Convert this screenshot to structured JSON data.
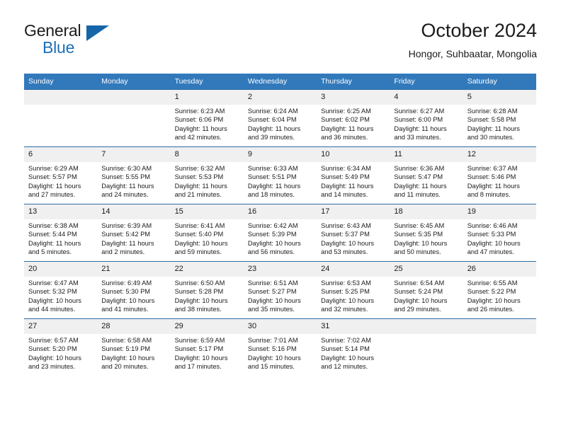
{
  "brand": {
    "line1": "General",
    "line2": "Blue",
    "flag_icon": "blue-flag-triangle-icon",
    "accent_color": "#1d6fb8"
  },
  "header": {
    "title": "October 2024",
    "location": "Hongor, Suhbaatar, Mongolia"
  },
  "theme": {
    "header_row_bg": "#3279bb",
    "daynum_bg": "#f0f0f0",
    "row_rule": "#2e6da4",
    "text": "#1b1b1b"
  },
  "weekdays": [
    "Sunday",
    "Monday",
    "Tuesday",
    "Wednesday",
    "Thursday",
    "Friday",
    "Saturday"
  ],
  "weeks": [
    [
      {
        "day": "",
        "sunrise": "",
        "sunset": "",
        "daylight1": "",
        "daylight2": "",
        "empty": true
      },
      {
        "day": "",
        "sunrise": "",
        "sunset": "",
        "daylight1": "",
        "daylight2": "",
        "empty": true
      },
      {
        "day": "1",
        "sunrise": "Sunrise: 6:23 AM",
        "sunset": "Sunset: 6:06 PM",
        "daylight1": "Daylight: 11 hours",
        "daylight2": "and 42 minutes."
      },
      {
        "day": "2",
        "sunrise": "Sunrise: 6:24 AM",
        "sunset": "Sunset: 6:04 PM",
        "daylight1": "Daylight: 11 hours",
        "daylight2": "and 39 minutes."
      },
      {
        "day": "3",
        "sunrise": "Sunrise: 6:25 AM",
        "sunset": "Sunset: 6:02 PM",
        "daylight1": "Daylight: 11 hours",
        "daylight2": "and 36 minutes."
      },
      {
        "day": "4",
        "sunrise": "Sunrise: 6:27 AM",
        "sunset": "Sunset: 6:00 PM",
        "daylight1": "Daylight: 11 hours",
        "daylight2": "and 33 minutes."
      },
      {
        "day": "5",
        "sunrise": "Sunrise: 6:28 AM",
        "sunset": "Sunset: 5:58 PM",
        "daylight1": "Daylight: 11 hours",
        "daylight2": "and 30 minutes."
      }
    ],
    [
      {
        "day": "6",
        "sunrise": "Sunrise: 6:29 AM",
        "sunset": "Sunset: 5:57 PM",
        "daylight1": "Daylight: 11 hours",
        "daylight2": "and 27 minutes."
      },
      {
        "day": "7",
        "sunrise": "Sunrise: 6:30 AM",
        "sunset": "Sunset: 5:55 PM",
        "daylight1": "Daylight: 11 hours",
        "daylight2": "and 24 minutes."
      },
      {
        "day": "8",
        "sunrise": "Sunrise: 6:32 AM",
        "sunset": "Sunset: 5:53 PM",
        "daylight1": "Daylight: 11 hours",
        "daylight2": "and 21 minutes."
      },
      {
        "day": "9",
        "sunrise": "Sunrise: 6:33 AM",
        "sunset": "Sunset: 5:51 PM",
        "daylight1": "Daylight: 11 hours",
        "daylight2": "and 18 minutes."
      },
      {
        "day": "10",
        "sunrise": "Sunrise: 6:34 AM",
        "sunset": "Sunset: 5:49 PM",
        "daylight1": "Daylight: 11 hours",
        "daylight2": "and 14 minutes."
      },
      {
        "day": "11",
        "sunrise": "Sunrise: 6:36 AM",
        "sunset": "Sunset: 5:47 PM",
        "daylight1": "Daylight: 11 hours",
        "daylight2": "and 11 minutes."
      },
      {
        "day": "12",
        "sunrise": "Sunrise: 6:37 AM",
        "sunset": "Sunset: 5:46 PM",
        "daylight1": "Daylight: 11 hours",
        "daylight2": "and 8 minutes."
      }
    ],
    [
      {
        "day": "13",
        "sunrise": "Sunrise: 6:38 AM",
        "sunset": "Sunset: 5:44 PM",
        "daylight1": "Daylight: 11 hours",
        "daylight2": "and 5 minutes."
      },
      {
        "day": "14",
        "sunrise": "Sunrise: 6:39 AM",
        "sunset": "Sunset: 5:42 PM",
        "daylight1": "Daylight: 11 hours",
        "daylight2": "and 2 minutes."
      },
      {
        "day": "15",
        "sunrise": "Sunrise: 6:41 AM",
        "sunset": "Sunset: 5:40 PM",
        "daylight1": "Daylight: 10 hours",
        "daylight2": "and 59 minutes."
      },
      {
        "day": "16",
        "sunrise": "Sunrise: 6:42 AM",
        "sunset": "Sunset: 5:39 PM",
        "daylight1": "Daylight: 10 hours",
        "daylight2": "and 56 minutes."
      },
      {
        "day": "17",
        "sunrise": "Sunrise: 6:43 AM",
        "sunset": "Sunset: 5:37 PM",
        "daylight1": "Daylight: 10 hours",
        "daylight2": "and 53 minutes."
      },
      {
        "day": "18",
        "sunrise": "Sunrise: 6:45 AM",
        "sunset": "Sunset: 5:35 PM",
        "daylight1": "Daylight: 10 hours",
        "daylight2": "and 50 minutes."
      },
      {
        "day": "19",
        "sunrise": "Sunrise: 6:46 AM",
        "sunset": "Sunset: 5:33 PM",
        "daylight1": "Daylight: 10 hours",
        "daylight2": "and 47 minutes."
      }
    ],
    [
      {
        "day": "20",
        "sunrise": "Sunrise: 6:47 AM",
        "sunset": "Sunset: 5:32 PM",
        "daylight1": "Daylight: 10 hours",
        "daylight2": "and 44 minutes."
      },
      {
        "day": "21",
        "sunrise": "Sunrise: 6:49 AM",
        "sunset": "Sunset: 5:30 PM",
        "daylight1": "Daylight: 10 hours",
        "daylight2": "and 41 minutes."
      },
      {
        "day": "22",
        "sunrise": "Sunrise: 6:50 AM",
        "sunset": "Sunset: 5:28 PM",
        "daylight1": "Daylight: 10 hours",
        "daylight2": "and 38 minutes."
      },
      {
        "day": "23",
        "sunrise": "Sunrise: 6:51 AM",
        "sunset": "Sunset: 5:27 PM",
        "daylight1": "Daylight: 10 hours",
        "daylight2": "and 35 minutes."
      },
      {
        "day": "24",
        "sunrise": "Sunrise: 6:53 AM",
        "sunset": "Sunset: 5:25 PM",
        "daylight1": "Daylight: 10 hours",
        "daylight2": "and 32 minutes."
      },
      {
        "day": "25",
        "sunrise": "Sunrise: 6:54 AM",
        "sunset": "Sunset: 5:24 PM",
        "daylight1": "Daylight: 10 hours",
        "daylight2": "and 29 minutes."
      },
      {
        "day": "26",
        "sunrise": "Sunrise: 6:55 AM",
        "sunset": "Sunset: 5:22 PM",
        "daylight1": "Daylight: 10 hours",
        "daylight2": "and 26 minutes."
      }
    ],
    [
      {
        "day": "27",
        "sunrise": "Sunrise: 6:57 AM",
        "sunset": "Sunset: 5:20 PM",
        "daylight1": "Daylight: 10 hours",
        "daylight2": "and 23 minutes."
      },
      {
        "day": "28",
        "sunrise": "Sunrise: 6:58 AM",
        "sunset": "Sunset: 5:19 PM",
        "daylight1": "Daylight: 10 hours",
        "daylight2": "and 20 minutes."
      },
      {
        "day": "29",
        "sunrise": "Sunrise: 6:59 AM",
        "sunset": "Sunset: 5:17 PM",
        "daylight1": "Daylight: 10 hours",
        "daylight2": "and 17 minutes."
      },
      {
        "day": "30",
        "sunrise": "Sunrise: 7:01 AM",
        "sunset": "Sunset: 5:16 PM",
        "daylight1": "Daylight: 10 hours",
        "daylight2": "and 15 minutes."
      },
      {
        "day": "31",
        "sunrise": "Sunrise: 7:02 AM",
        "sunset": "Sunset: 5:14 PM",
        "daylight1": "Daylight: 10 hours",
        "daylight2": "and 12 minutes."
      },
      {
        "day": "",
        "sunrise": "",
        "sunset": "",
        "daylight1": "",
        "daylight2": "",
        "empty": true
      },
      {
        "day": "",
        "sunrise": "",
        "sunset": "",
        "daylight1": "",
        "daylight2": "",
        "empty": true
      }
    ]
  ]
}
